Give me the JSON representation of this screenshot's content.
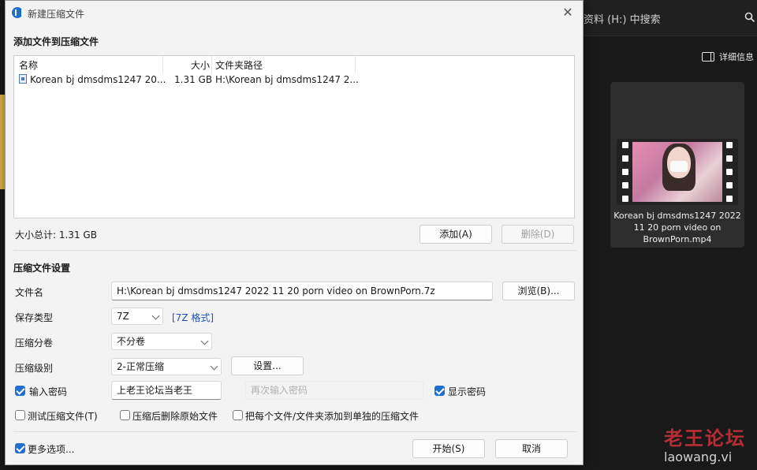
{
  "background": {
    "search_text": "资料 (H:) 中搜索",
    "details_label": "详细信息",
    "file_caption": "Korean bj dmsdms1247 2022 11 20 porn video on BrownPorn.mp4",
    "watermark_title": "老王论坛",
    "watermark_url": "laowang.vi"
  },
  "dialog": {
    "title": "新建压缩文件",
    "close_glyph": "✕",
    "add_section_title": "添加文件到压缩文件",
    "list": {
      "headers": {
        "name": "名称",
        "size": "大小",
        "path": "文件夹路径"
      },
      "rows": [
        {
          "name": "Korean bj dmsdms1247 20...",
          "size": "1.31 GB",
          "path": "H:\\Korean bj dmsdms1247 2..."
        }
      ]
    },
    "total_label": "大小总计: 1.31 GB",
    "add_button": "添加(A)",
    "delete_button": "删除(D)",
    "settings_section_title": "压缩文件设置",
    "filename_label": "文件名",
    "filename_value": "H:\\Korean bj dmsdms1247 2022 11 20 porn video on BrownPorn.7z",
    "browse_button": "浏览(B)...",
    "save_type_label": "保存类型",
    "save_type_value": "7Z",
    "format_link": "[7Z 格式]",
    "volume_label": "压缩分卷",
    "volume_value": "不分卷",
    "level_label": "压缩级别",
    "level_value": "2-正常压缩",
    "settings_button": "设置...",
    "password_label": "输入密码",
    "password_value": "上老王论坛当老王",
    "password_confirm_placeholder": "再次输入密码",
    "show_password_label": "显示密码",
    "test_label": "测试压缩文件(T)",
    "delete_after_label": "压缩后删除原始文件",
    "separate_label": "把每个文件/文件夹添加到单独的压缩文件",
    "more_options_label": "更多选项...",
    "start_button": "开始(S)",
    "cancel_button": "取消"
  },
  "colors": {
    "accent": "#1f6fd1",
    "link": "#1f4fc7",
    "watermark": "#c9303a"
  }
}
